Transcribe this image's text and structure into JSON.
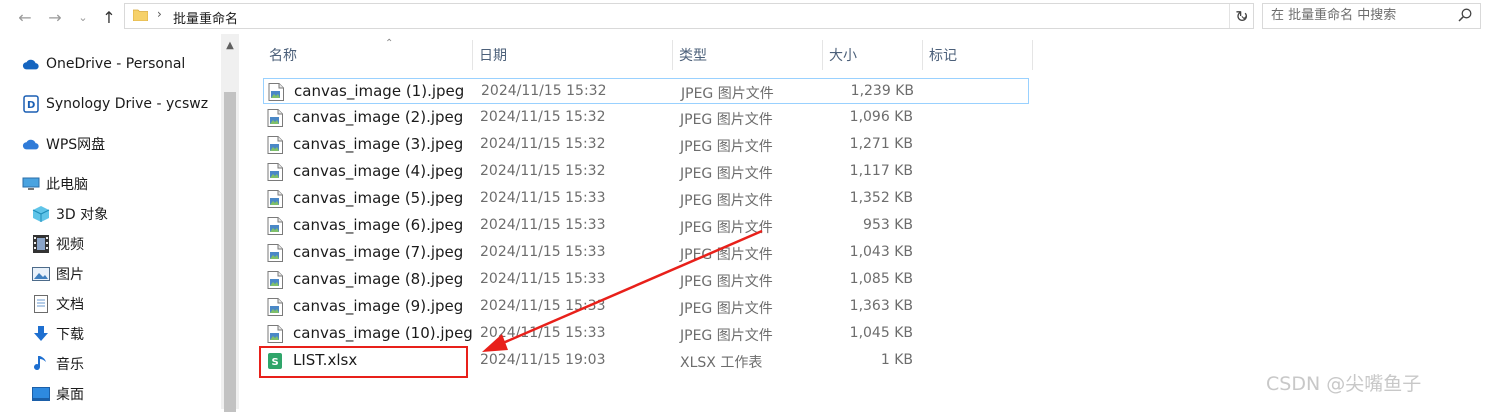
{
  "nav": {
    "back_icon": "arrow-left-icon",
    "forward_icon": "arrow-right-icon",
    "recent_icon": "chevron-down-icon",
    "up_icon": "arrow-up-icon"
  },
  "address": {
    "path": "批量重命名",
    "separator": "›"
  },
  "search": {
    "placeholder": "在 批量重命名 中搜索"
  },
  "sidebar": {
    "items": [
      {
        "label": "OneDrive - Personal",
        "icon": "cloud-icon"
      },
      {
        "label": "Synology Drive - ycswz",
        "icon": "synology-drive-icon"
      },
      {
        "label": "WPS网盘",
        "icon": "wps-cloud-icon"
      },
      {
        "label": "此电脑",
        "icon": "computer-icon"
      },
      {
        "label": "3D 对象",
        "icon": "3d-objects-icon"
      },
      {
        "label": "视频",
        "icon": "video-icon"
      },
      {
        "label": "图片",
        "icon": "pictures-icon"
      },
      {
        "label": "文档",
        "icon": "documents-icon"
      },
      {
        "label": "下载",
        "icon": "downloads-icon"
      },
      {
        "label": "音乐",
        "icon": "music-icon"
      },
      {
        "label": "桌面",
        "icon": "desktop-icon"
      }
    ]
  },
  "columns": {
    "name": "名称",
    "date": "日期",
    "type": "类型",
    "size": "大小",
    "tags": "标记"
  },
  "files": [
    {
      "name": "canvas_image (1).jpeg",
      "date": "2024/11/15 15:32",
      "type": "JPEG 图片文件",
      "size": "1,239 KB"
    },
    {
      "name": "canvas_image (2).jpeg",
      "date": "2024/11/15 15:32",
      "type": "JPEG 图片文件",
      "size": "1,096 KB"
    },
    {
      "name": "canvas_image (3).jpeg",
      "date": "2024/11/15 15:32",
      "type": "JPEG 图片文件",
      "size": "1,271 KB"
    },
    {
      "name": "canvas_image (4).jpeg",
      "date": "2024/11/15 15:32",
      "type": "JPEG 图片文件",
      "size": "1,117 KB"
    },
    {
      "name": "canvas_image (5).jpeg",
      "date": "2024/11/15 15:33",
      "type": "JPEG 图片文件",
      "size": "1,352 KB"
    },
    {
      "name": "canvas_image (6).jpeg",
      "date": "2024/11/15 15:33",
      "type": "JPEG 图片文件",
      "size": "953 KB"
    },
    {
      "name": "canvas_image (7).jpeg",
      "date": "2024/11/15 15:33",
      "type": "JPEG 图片文件",
      "size": "1,043 KB"
    },
    {
      "name": "canvas_image (8).jpeg",
      "date": "2024/11/15 15:33",
      "type": "JPEG 图片文件",
      "size": "1,085 KB"
    },
    {
      "name": "canvas_image (9).jpeg",
      "date": "2024/11/15 15:33",
      "type": "JPEG 图片文件",
      "size": "1,363 KB"
    },
    {
      "name": "canvas_image (10).jpeg",
      "date": "2024/11/15 15:33",
      "type": "JPEG 图片文件",
      "size": "1,045 KB"
    },
    {
      "name": "LIST.xlsx",
      "date": "2024/11/15 19:03",
      "type": "XLSX 工作表",
      "size": "1 KB"
    }
  ],
  "watermark": "CSDN @尖嘴鱼子",
  "colors": {
    "selection_border": "#99d1ff",
    "annotation_red": "#e8201a",
    "header_text": "#4c607a"
  }
}
